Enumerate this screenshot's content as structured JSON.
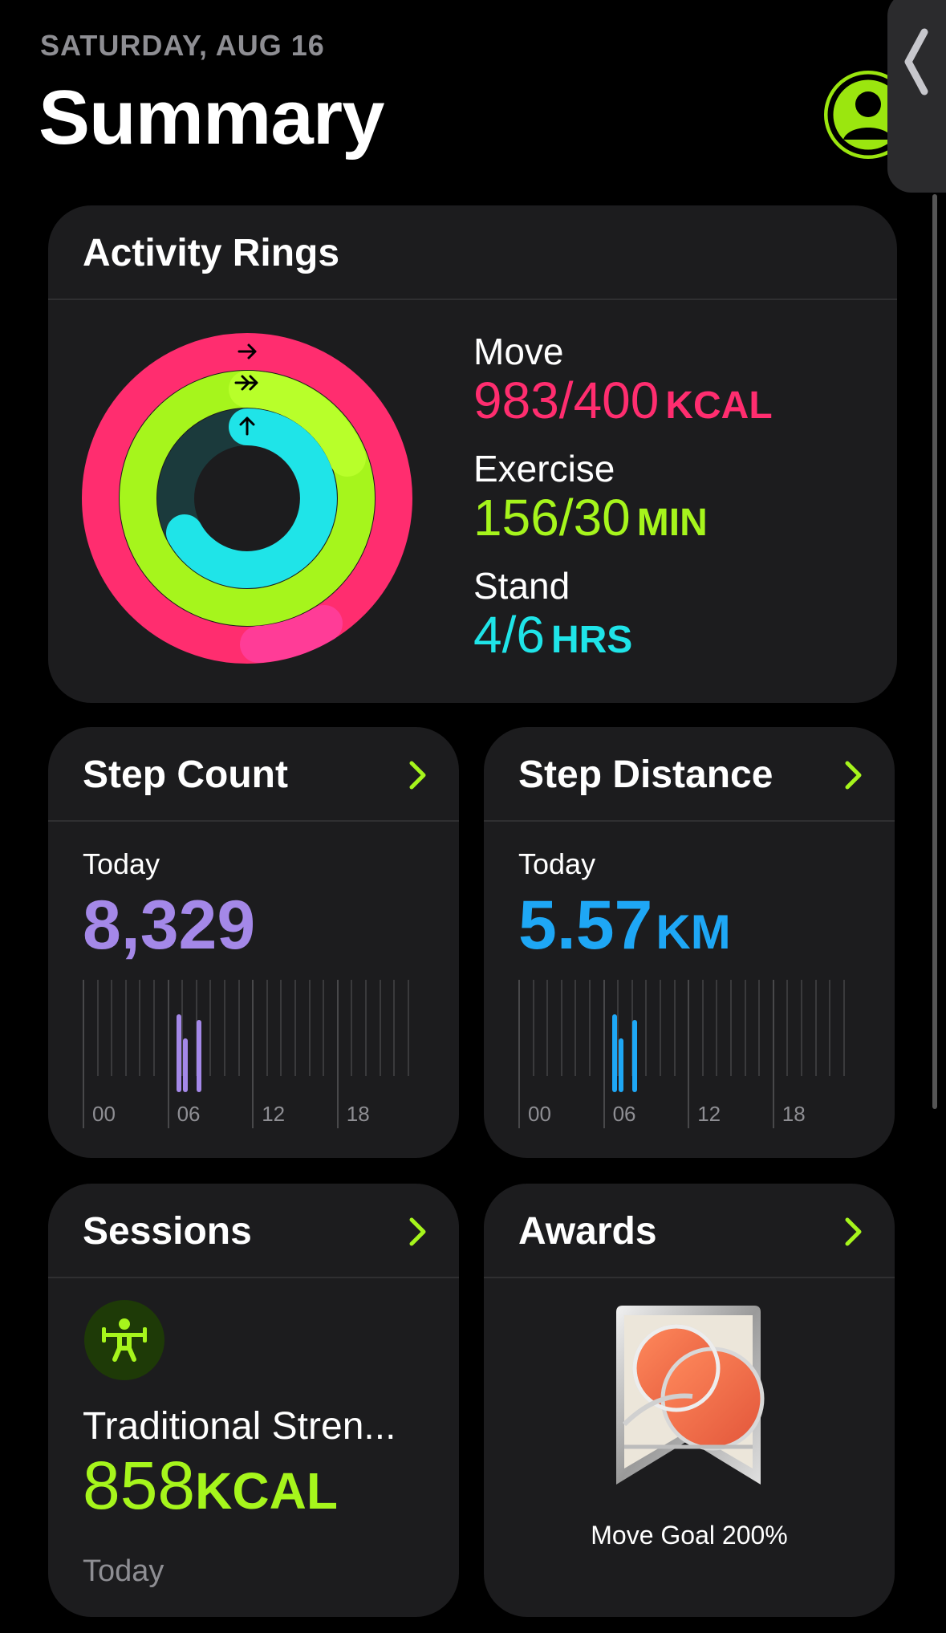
{
  "header": {
    "date": "SATURDAY, AUG 16",
    "title": "Summary"
  },
  "activity": {
    "title": "Activity Rings",
    "move": {
      "label": "Move",
      "value": "983/400",
      "unit": "KCAL",
      "color": "#ff2d6f",
      "progress": 2.4575
    },
    "exercise": {
      "label": "Exercise",
      "value": "156/30",
      "unit": "MIN",
      "color": "#a6f51c",
      "progress": 5.2
    },
    "stand": {
      "label": "Stand",
      "value": "4/6",
      "unit": "HRS",
      "color": "#1fe4e8",
      "progress": 0.667
    }
  },
  "step_count": {
    "title": "Step Count",
    "label": "Today",
    "value": "8,329",
    "color": "#a488e8",
    "axis": [
      "00",
      "06",
      "12",
      "18"
    ]
  },
  "step_distance": {
    "title": "Step Distance",
    "label": "Today",
    "value": "5.57",
    "unit": "KM",
    "color": "#1ea7f5",
    "axis": [
      "00",
      "06",
      "12",
      "18"
    ]
  },
  "sessions": {
    "title": "Sessions",
    "name": "Traditional Stren...",
    "value": "858",
    "unit": "KCAL",
    "when": "Today",
    "icon": "strength-training-icon"
  },
  "awards": {
    "title": "Awards",
    "label": "Move Goal 200%",
    "icon": "move-goal-badge-icon"
  }
}
